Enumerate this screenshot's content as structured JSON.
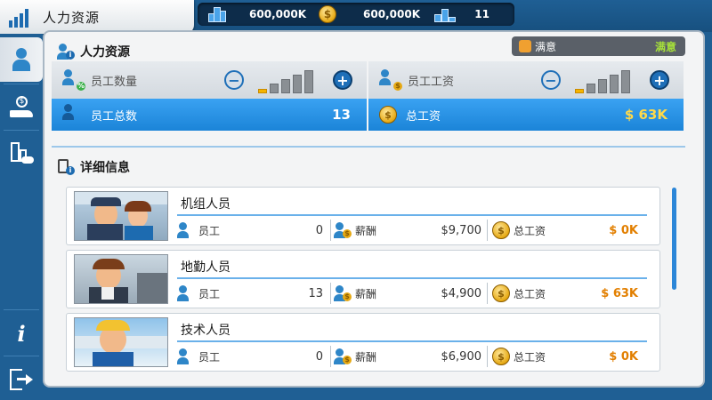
{
  "header": {
    "title": "人力资源",
    "money": "600,000K",
    "coins": "600,000K",
    "rank": "11"
  },
  "sidebar": {
    "items": [
      {
        "icon": "person-icon",
        "active": true
      },
      {
        "icon": "hand-money-icon"
      },
      {
        "icon": "building-handshake-icon"
      },
      {
        "icon": "info-icon"
      },
      {
        "icon": "exit-icon"
      }
    ]
  },
  "hr": {
    "section_title": "人力资源",
    "satisfaction_label": "满意",
    "satisfaction_value": "满意",
    "staff_count_label": "员工数量",
    "staff_salary_label": "员工工资",
    "total_staff_label": "员工总数",
    "total_staff_value": "13",
    "total_salary_label": "总工资",
    "total_salary_value": "$ 63K",
    "staff_count_level": 1,
    "staff_salary_level": 1,
    "level_max": 5
  },
  "details": {
    "section_title": "详细信息",
    "cards": [
      {
        "name": "机组人员",
        "staff_label": "员工",
        "staff_value": "0",
        "salary_label": "薪酬",
        "salary_value": "$9,700",
        "total_label": "总工资",
        "total_value": "$ 0K"
      },
      {
        "name": "地勤人员",
        "staff_label": "员工",
        "staff_value": "13",
        "salary_label": "薪酬",
        "salary_value": "$4,900",
        "total_label": "总工资",
        "total_value": "$ 63K"
      },
      {
        "name": "技术人员",
        "staff_label": "员工",
        "staff_value": "0",
        "salary_label": "薪酬",
        "salary_value": "$6,900",
        "total_label": "总工资",
        "total_value": "$ 0K"
      }
    ]
  },
  "colors": {
    "accent_blue": "#1b84d8",
    "money_yellow": "#ffd94a",
    "orange_value": "#e27f00",
    "satisfaction_green": "#a6e03a"
  }
}
